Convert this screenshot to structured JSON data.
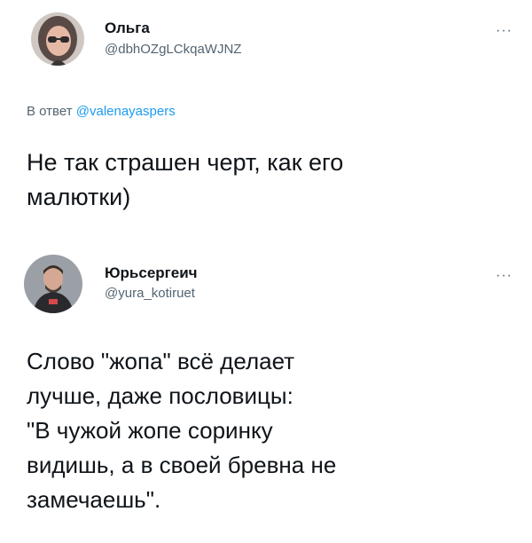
{
  "tweets": [
    {
      "name": "Ольга",
      "handle": "@dbhOZgLCkqaWJNZ",
      "more": "···",
      "reply_prefix": "В ответ",
      "reply_to": "@valenayaspers",
      "text": "Не так страшен черт, как его\nмалютки)",
      "avatar_icon": "user-photo-woman"
    },
    {
      "name": "Юрьсергеич",
      "handle": "@yura_kotiruet",
      "more": "···",
      "text": "Слово \"жопа\" всё делает\nлучше, даже пословицы:\n\"В чужой жопе соринку\nвидишь, а в своей бревна не\nзамечаешь\".",
      "avatar_icon": "user-photo-man"
    }
  ],
  "colors": {
    "text": "#0f1419",
    "secondary": "#536471",
    "link": "#1d9bf0",
    "background": "#ffffff"
  }
}
